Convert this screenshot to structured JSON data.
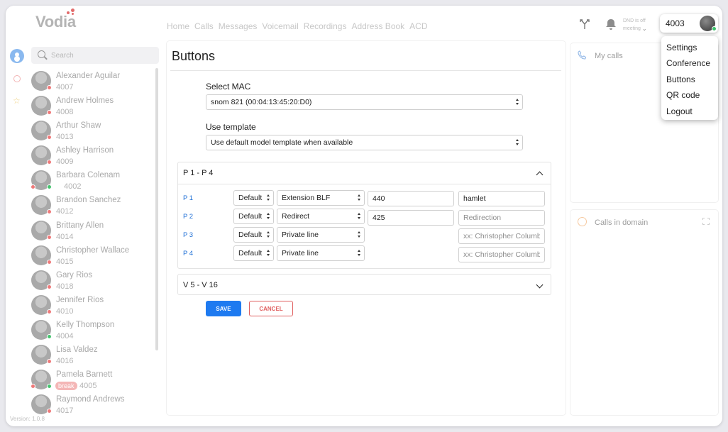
{
  "app": {
    "logo": "Vodia",
    "version": "Version: 1.0.8"
  },
  "nav": [
    "Home",
    "Calls",
    "Messages",
    "Voicemail",
    "Recordings",
    "Address Book",
    "ACD"
  ],
  "status": {
    "dnd": "DND is off",
    "mode": "meeting"
  },
  "user": {
    "extension": "4003"
  },
  "user_menu": [
    "Settings",
    "Conference",
    "Buttons",
    "QR code",
    "Logout"
  ],
  "search": {
    "placeholder": "Search"
  },
  "contacts": [
    {
      "name": "Alexander Aguilar",
      "ext": "4007"
    },
    {
      "name": "Andrew Holmes",
      "ext": "4008"
    },
    {
      "name": "Arthur Shaw",
      "ext": "4013"
    },
    {
      "name": "Ashley Harrison",
      "ext": "4009"
    },
    {
      "name": "Barbara Colenam",
      "ext": "4002"
    },
    {
      "name": "Brandon Sanchez",
      "ext": "4012"
    },
    {
      "name": "Brittany Allen",
      "ext": "4014"
    },
    {
      "name": "Christopher Wallace",
      "ext": "4015"
    },
    {
      "name": "Gary Rios",
      "ext": "4018"
    },
    {
      "name": "Jennifer Rios",
      "ext": "4010"
    },
    {
      "name": "Kelly Thompson",
      "ext": "4004"
    },
    {
      "name": "Lisa Valdez",
      "ext": "4016"
    },
    {
      "name": "Pamela Barnett",
      "ext": "4005",
      "badge": "break"
    },
    {
      "name": "Raymond Andrews",
      "ext": "4017"
    }
  ],
  "page": {
    "title": "Buttons",
    "select_mac_label": "Select MAC",
    "select_mac_value": "snom 821 (00:04:13:45:20:D0)",
    "template_label": "Use template",
    "template_value": "Use default model template when available",
    "section1": "P 1 - P 4",
    "section2": "V 5 - V 16",
    "rows": [
      {
        "label": "P 1",
        "mode": "Default",
        "type": "Extension BLF",
        "number": "440",
        "name": "hamlet",
        "name_placeholder": ""
      },
      {
        "label": "P 2",
        "mode": "Default",
        "type": "Redirect",
        "number": "425",
        "name": "",
        "name_placeholder": "Redirection"
      },
      {
        "label": "P 3",
        "mode": "Default",
        "type": "Private line",
        "number": "",
        "name": "",
        "name_placeholder": "xx: Christopher Columbus"
      },
      {
        "label": "P 4",
        "mode": "Default",
        "type": "Private line",
        "number": "",
        "name": "",
        "name_placeholder": "xx: Christopher Columbus"
      }
    ],
    "save": "SAVE",
    "cancel": "CANCEL"
  },
  "right": {
    "my_calls": "My calls",
    "calls_in_domain": "Calls in domain"
  },
  "colors": {
    "accent": "#1e7af0",
    "danger": "#e06060",
    "online": "#46c46f",
    "offline": "#ef7a7a"
  }
}
